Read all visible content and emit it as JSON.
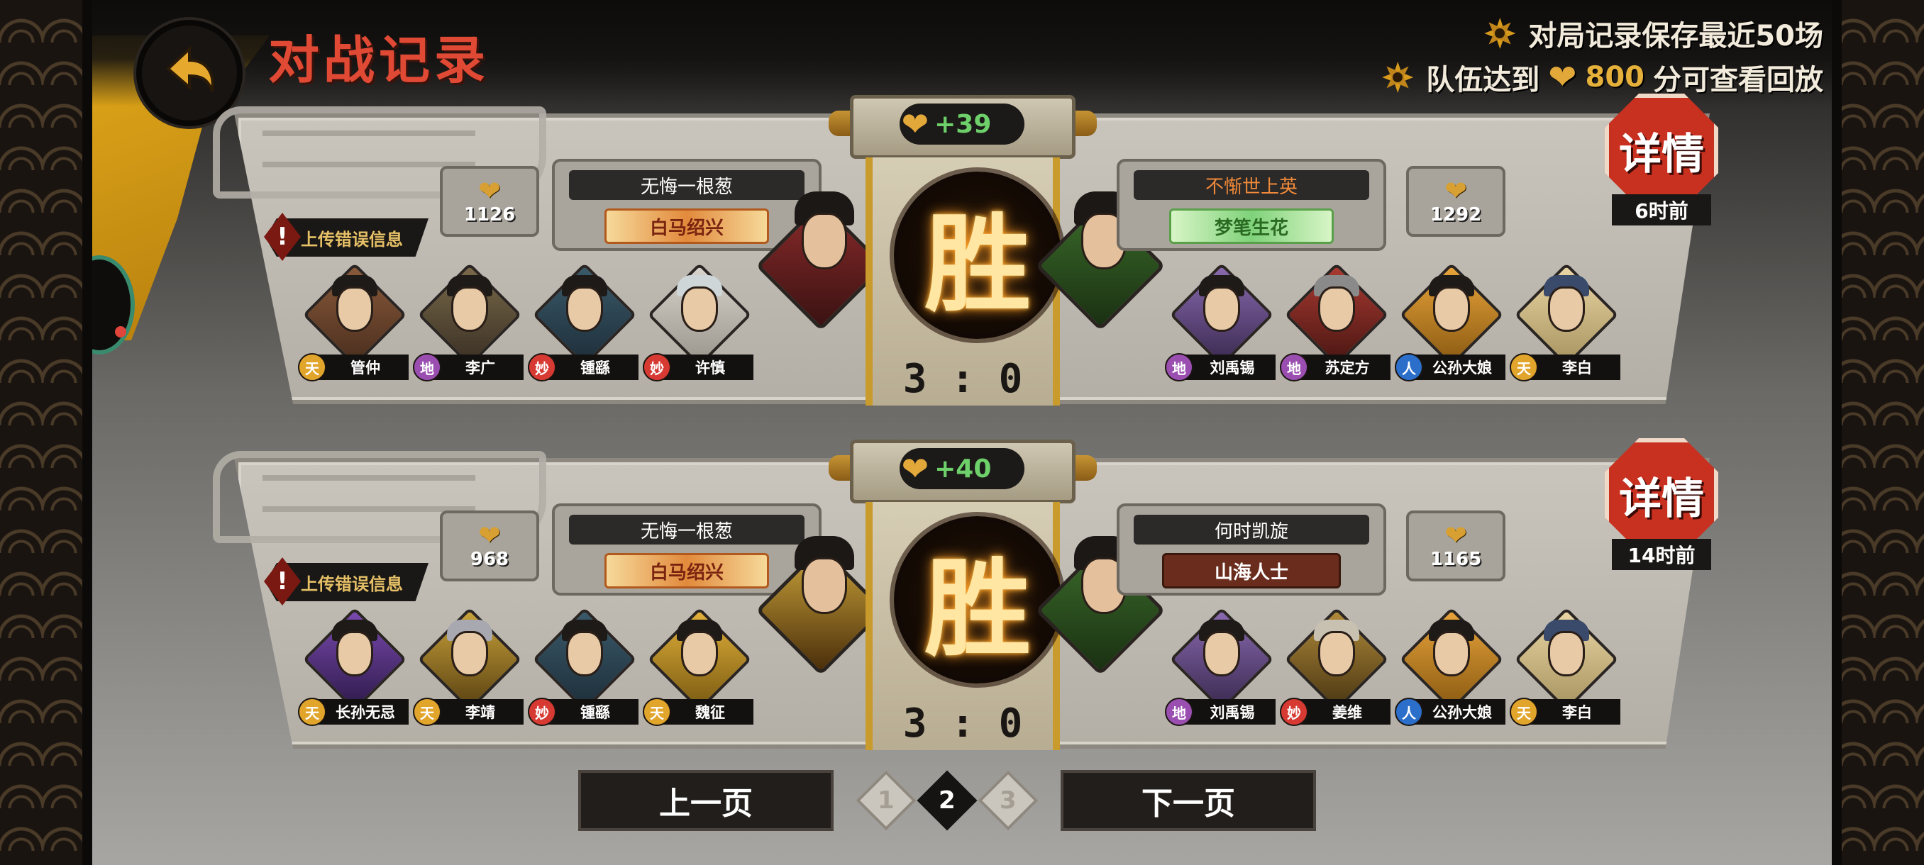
{
  "header": {
    "title": "对战记录",
    "info_line1": "对局记录保存最近50场",
    "info_line2_prefix": "队伍达到",
    "info_line2_value": "800",
    "info_line2_suffix": "分可查看回放"
  },
  "report_label": "上传错误信息",
  "detail_label": "详情",
  "matches": [
    {
      "delta": "+39",
      "result": "胜",
      "score": "3 : 0",
      "time": "6时前",
      "left": {
        "player": "无悔一根葱",
        "title_tag": "白马绍兴",
        "points": "1126",
        "heroes": [
          {
            "rank": "天",
            "name": "管仲"
          },
          {
            "rank": "地",
            "name": "李广"
          },
          {
            "rank": "妙",
            "name": "锺繇"
          },
          {
            "rank": "妙",
            "name": "许慎"
          }
        ]
      },
      "right": {
        "player": "不惭世上英",
        "title_tag": "梦笔生花",
        "points": "1292",
        "heroes": [
          {
            "rank": "地",
            "name": "刘禹锡"
          },
          {
            "rank": "地",
            "name": "苏定方"
          },
          {
            "rank": "人",
            "name": "公孙大娘"
          },
          {
            "rank": "天",
            "name": "李白"
          }
        ]
      }
    },
    {
      "delta": "+40",
      "result": "胜",
      "score": "3 : 0",
      "time": "14时前",
      "left": {
        "player": "无悔一根葱",
        "title_tag": "白马绍兴",
        "points": "968",
        "heroes": [
          {
            "rank": "天",
            "name": "长孙无忌"
          },
          {
            "rank": "天",
            "name": "李靖"
          },
          {
            "rank": "妙",
            "name": "锺繇"
          },
          {
            "rank": "天",
            "name": "魏征"
          }
        ]
      },
      "right": {
        "player": "何时凯旋",
        "title_tag": "山海人士",
        "points": "1165",
        "heroes": [
          {
            "rank": "地",
            "name": "刘禹锡"
          },
          {
            "rank": "妙",
            "name": "姜维"
          },
          {
            "rank": "人",
            "name": "公孙大娘"
          },
          {
            "rank": "天",
            "name": "李白"
          }
        ]
      }
    }
  ],
  "pager": {
    "prev": "上一页",
    "next": "下一页",
    "pages": [
      "1",
      "2",
      "3"
    ],
    "current": "2"
  },
  "icons": {
    "back": "back-arrow-icon",
    "flower": "flower-icon",
    "heart": "heart-hand-icon",
    "warning": "warning-icon"
  },
  "colors": {
    "title_red": "#e04a35",
    "gold": "#e6b13a",
    "win_glow": "#ff9a20",
    "delta_green": "#6ed06a",
    "detail_red": "#c8301f"
  }
}
